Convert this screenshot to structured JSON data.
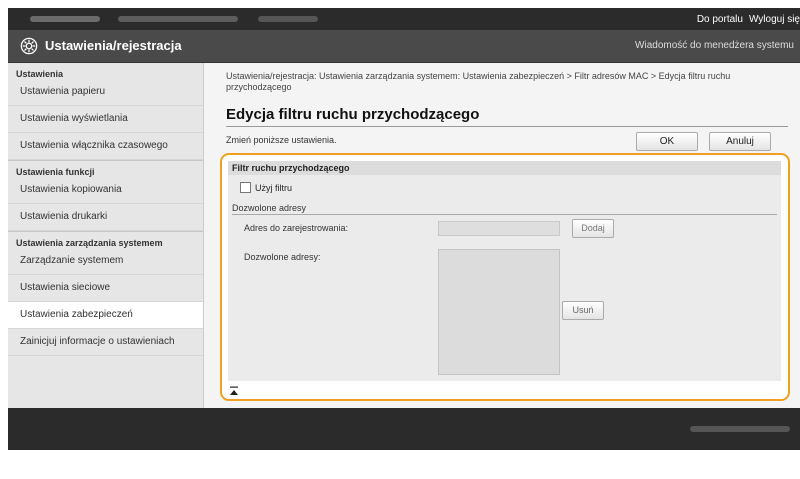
{
  "top_links": {
    "portal": "Do portalu",
    "logout": "Wyloguj się"
  },
  "header": {
    "title": "Ustawienia/rejestracja",
    "admin_message": "Wiadomość do menedżera systemu"
  },
  "sidebar": {
    "sections": [
      {
        "heading": "Ustawienia",
        "items": [
          "Ustawienia papieru",
          "Ustawienia wyświetlania",
          "Ustawienia włącznika czasowego"
        ]
      },
      {
        "heading": "Ustawienia funkcji",
        "items": [
          "Ustawienia kopiowania",
          "Ustawienia drukarki"
        ]
      },
      {
        "heading": "Ustawienia zarządzania systemem",
        "items": [
          "Zarządzanie systemem",
          "Ustawienia sieciowe",
          "Ustawienia zabezpieczeń",
          "Zainicjuj informacje o ustawieniach"
        ]
      }
    ],
    "active_item": "Ustawienia zabezpieczeń"
  },
  "main": {
    "breadcrumb": "Ustawienia/rejestracja: Ustawienia zarządzania systemem: Ustawienia zabezpieczeń > Filtr adresów MAC > Edycja filtru ruchu przychodzącego",
    "title": "Edycja filtru ruchu przychodzącego",
    "instruction": "Zmień poniższe ustawienia.",
    "ok_label": "OK",
    "cancel_label": "Anuluj",
    "filter_section": "Filtr ruchu przychodzącego",
    "use_filter_label": "Użyj filtru",
    "use_filter_checked": false,
    "allowed_heading": "Dozwolone adresy",
    "address_label": "Adres do zarejestrowania:",
    "address_value": "",
    "add_label": "Dodaj",
    "list_label": "Dozwolone adresy:",
    "remove_label": "Usuń"
  },
  "colors": {
    "highlight": "#f0a020",
    "titlebar": "#4a4a4a",
    "topbar": "#2b2b2b"
  }
}
